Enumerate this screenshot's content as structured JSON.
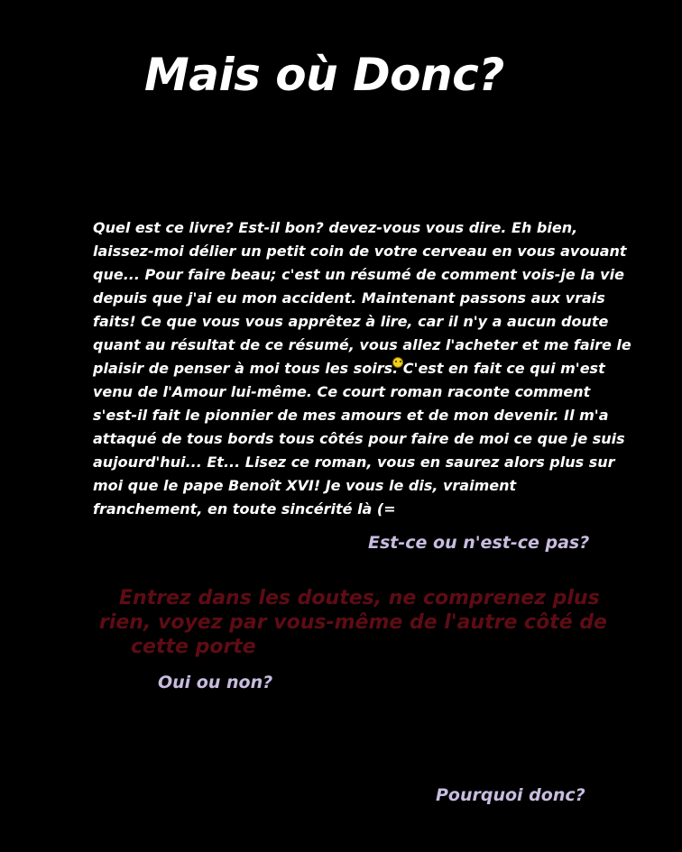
{
  "title": "Mais où Donc?",
  "body_lines": [
    "Quel est ce livre? Est-il bon? devez-vous vous dire. Eh bien,",
    "laissez-moi délier un petit coin de votre cerveau en vous avouant",
    "que... Pour faire beau; c'est un résumé de comment vois-je la vie",
    "depuis que j'ai eu mon accident. Maintenant passons aux vrais",
    "faits! Ce que vous vous apprêtez à lire, car il n'y a aucun doute",
    "quant au résultat de ce résumé, vous allez l'acheter et me faire le",
    "plaisir de penser à moi tous les soirs.",
    " C'est en fait ce qui m'est",
    "venu de l'Amour lui-même. Ce court roman raconte comment",
    "s'est-il fait le pionnier de mes amours et de mon devenir. Il m'a",
    "attaqué de tous bords tous côtés pour faire de moi ce que je suis",
    "aujourd'hui... Et... Lisez ce roman, vous en saurez alors plus sur",
    "moi que le pape Benoît XVI! Je vous le dis, vraiment",
    "franchement, en toute sincérité là (="
  ],
  "emoji_icon": "smiley-icon",
  "question_1": "Est-ce ou n'est-ce pas?",
  "red_lines": [
    "Entrez dans les doutes, ne comprenez plus",
    "rien, voyez par vous-même de l'autre côté de",
    "cette porte"
  ],
  "question_2": "Oui ou non?",
  "question_3": "Pourquoi donc?",
  "colors": {
    "background": "#000000",
    "text": "#ffffff",
    "question": "#c8bde0",
    "red_text": "#5e0c14"
  }
}
